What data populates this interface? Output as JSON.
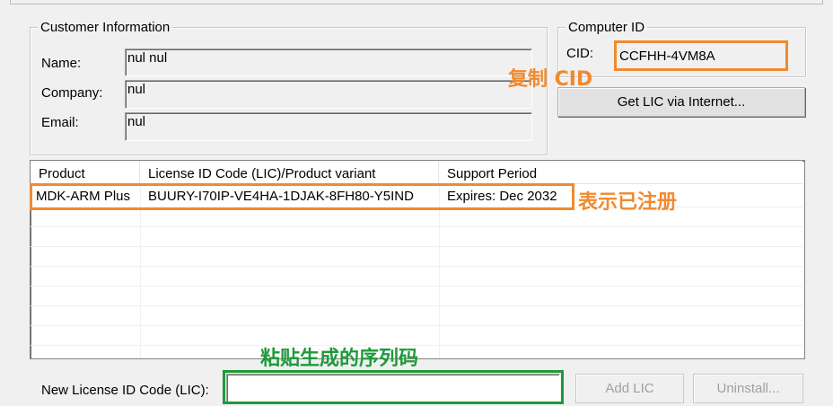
{
  "customer_info": {
    "legend": "Customer Information",
    "name_label": "Name:",
    "name_value": "nul nul",
    "company_label": "Company:",
    "company_value": "nul",
    "email_label": "Email:",
    "email_value": "nul"
  },
  "computer_id": {
    "legend": "Computer ID",
    "cid_label": "CID:",
    "cid_value": "CCFHH-4VM8A",
    "get_lic_button": "Get LIC via Internet..."
  },
  "license_table": {
    "columns": [
      "Product",
      "License ID Code (LIC)/Product variant",
      "Support Period"
    ],
    "rows": [
      {
        "product": "MDK-ARM Plus",
        "lic": "BUURY-I70IP-VE4HA-1DJAK-8FH80-Y5IND",
        "support": "Expires: Dec 2032"
      }
    ]
  },
  "new_lic": {
    "label": "New License ID Code (LIC):",
    "value": "",
    "add_button": "Add LIC",
    "uninstall_button": "Uninstall..."
  },
  "annotations": {
    "copy_cid": "复制 CID",
    "registered": "表示已注册",
    "paste_serial": "粘贴生成的序列码",
    "orange": "#f08a30",
    "green": "#1e9a3a"
  }
}
